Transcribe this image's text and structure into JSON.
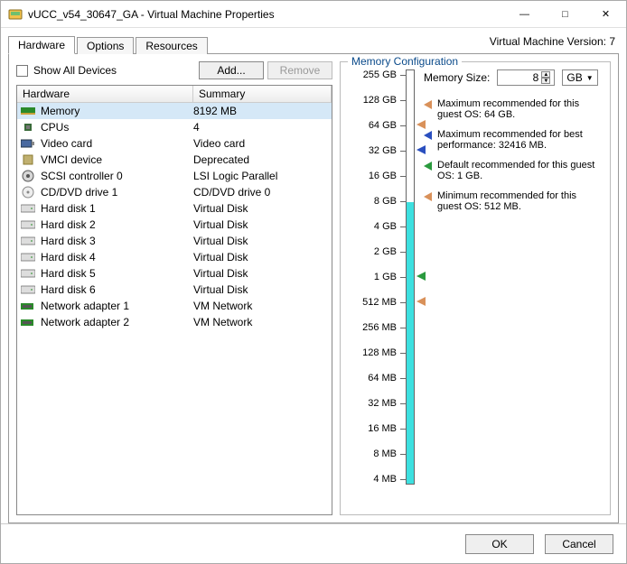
{
  "title": "vUCC_v54_30647_GA - Virtual Machine Properties",
  "version_label": "Virtual Machine Version: 7",
  "tabs": {
    "hardware": "Hardware",
    "options": "Options",
    "resources": "Resources"
  },
  "show_all": "Show All Devices",
  "buttons": {
    "add": "Add...",
    "remove": "Remove",
    "ok": "OK",
    "cancel": "Cancel"
  },
  "columns": {
    "hardware": "Hardware",
    "summary": "Summary"
  },
  "hw": [
    {
      "name": "Memory",
      "summary": "8192 MB",
      "icon": "mem",
      "selected": true
    },
    {
      "name": "CPUs",
      "summary": "4",
      "icon": "cpu"
    },
    {
      "name": "Video card",
      "summary": "Video card",
      "icon": "video"
    },
    {
      "name": "VMCI device",
      "summary": "Deprecated",
      "icon": "vmci"
    },
    {
      "name": "SCSI controller 0",
      "summary": "LSI Logic Parallel",
      "icon": "scsi"
    },
    {
      "name": "CD/DVD drive 1",
      "summary": "CD/DVD drive 0",
      "icon": "cd"
    },
    {
      "name": "Hard disk 1",
      "summary": "Virtual Disk",
      "icon": "hdd"
    },
    {
      "name": "Hard disk 2",
      "summary": "Virtual Disk",
      "icon": "hdd"
    },
    {
      "name": "Hard disk 3",
      "summary": "Virtual Disk",
      "icon": "hdd"
    },
    {
      "name": "Hard disk 4",
      "summary": "Virtual Disk",
      "icon": "hdd"
    },
    {
      "name": "Hard disk 5",
      "summary": "Virtual Disk",
      "icon": "hdd"
    },
    {
      "name": "Hard disk 6",
      "summary": "Virtual Disk",
      "icon": "hdd"
    },
    {
      "name": "Network adapter 1",
      "summary": "VM Network",
      "icon": "net"
    },
    {
      "name": "Network adapter 2",
      "summary": "VM Network",
      "icon": "net"
    }
  ],
  "memcfg": {
    "legend": "Memory Configuration",
    "size_label": "Memory Size:",
    "size_value": "8",
    "size_unit": "GB",
    "ticks": [
      "255 GB",
      "128 GB",
      "64 GB",
      "32 GB",
      "16 GB",
      "8 GB",
      "4 GB",
      "2 GB",
      "1 GB",
      "512 MB",
      "256 MB",
      "128 MB",
      "64 MB",
      "32 MB",
      "16 MB",
      "8 MB",
      "4 MB"
    ],
    "markers": {
      "max_guest": {
        "color": "#d9915a",
        "text": "Maximum recommended for this guest OS: 64 GB.",
        "tick": 2
      },
      "max_perf": {
        "color": "#2a4fbf",
        "text": "Maximum recommended for best performance: 32416 MB.",
        "tick": 3
      },
      "default": {
        "color": "#2a9a3e",
        "text": "Default recommended for this guest OS: 1 GB.",
        "tick": 8
      },
      "min_guest": {
        "color": "#d9915a",
        "text": "Minimum recommended for this guest OS: 512 MB.",
        "tick": 9
      }
    },
    "fill_tick": 5
  }
}
